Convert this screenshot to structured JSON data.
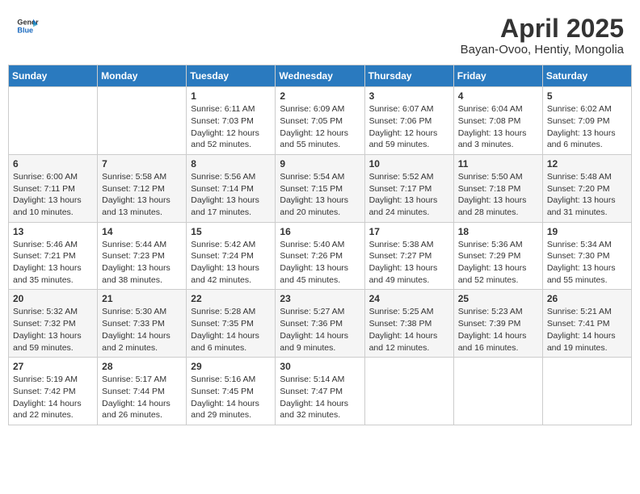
{
  "header": {
    "logo_line1": "General",
    "logo_line2": "Blue",
    "title": "April 2025",
    "subtitle": "Bayan-Ovoo, Hentiy, Mongolia"
  },
  "weekdays": [
    "Sunday",
    "Monday",
    "Tuesday",
    "Wednesday",
    "Thursday",
    "Friday",
    "Saturday"
  ],
  "weeks": [
    [
      {
        "day": "",
        "info": ""
      },
      {
        "day": "",
        "info": ""
      },
      {
        "day": "1",
        "info": "Sunrise: 6:11 AM\nSunset: 7:03 PM\nDaylight: 12 hours\nand 52 minutes."
      },
      {
        "day": "2",
        "info": "Sunrise: 6:09 AM\nSunset: 7:05 PM\nDaylight: 12 hours\nand 55 minutes."
      },
      {
        "day": "3",
        "info": "Sunrise: 6:07 AM\nSunset: 7:06 PM\nDaylight: 12 hours\nand 59 minutes."
      },
      {
        "day": "4",
        "info": "Sunrise: 6:04 AM\nSunset: 7:08 PM\nDaylight: 13 hours\nand 3 minutes."
      },
      {
        "day": "5",
        "info": "Sunrise: 6:02 AM\nSunset: 7:09 PM\nDaylight: 13 hours\nand 6 minutes."
      }
    ],
    [
      {
        "day": "6",
        "info": "Sunrise: 6:00 AM\nSunset: 7:11 PM\nDaylight: 13 hours\nand 10 minutes."
      },
      {
        "day": "7",
        "info": "Sunrise: 5:58 AM\nSunset: 7:12 PM\nDaylight: 13 hours\nand 13 minutes."
      },
      {
        "day": "8",
        "info": "Sunrise: 5:56 AM\nSunset: 7:14 PM\nDaylight: 13 hours\nand 17 minutes."
      },
      {
        "day": "9",
        "info": "Sunrise: 5:54 AM\nSunset: 7:15 PM\nDaylight: 13 hours\nand 20 minutes."
      },
      {
        "day": "10",
        "info": "Sunrise: 5:52 AM\nSunset: 7:17 PM\nDaylight: 13 hours\nand 24 minutes."
      },
      {
        "day": "11",
        "info": "Sunrise: 5:50 AM\nSunset: 7:18 PM\nDaylight: 13 hours\nand 28 minutes."
      },
      {
        "day": "12",
        "info": "Sunrise: 5:48 AM\nSunset: 7:20 PM\nDaylight: 13 hours\nand 31 minutes."
      }
    ],
    [
      {
        "day": "13",
        "info": "Sunrise: 5:46 AM\nSunset: 7:21 PM\nDaylight: 13 hours\nand 35 minutes."
      },
      {
        "day": "14",
        "info": "Sunrise: 5:44 AM\nSunset: 7:23 PM\nDaylight: 13 hours\nand 38 minutes."
      },
      {
        "day": "15",
        "info": "Sunrise: 5:42 AM\nSunset: 7:24 PM\nDaylight: 13 hours\nand 42 minutes."
      },
      {
        "day": "16",
        "info": "Sunrise: 5:40 AM\nSunset: 7:26 PM\nDaylight: 13 hours\nand 45 minutes."
      },
      {
        "day": "17",
        "info": "Sunrise: 5:38 AM\nSunset: 7:27 PM\nDaylight: 13 hours\nand 49 minutes."
      },
      {
        "day": "18",
        "info": "Sunrise: 5:36 AM\nSunset: 7:29 PM\nDaylight: 13 hours\nand 52 minutes."
      },
      {
        "day": "19",
        "info": "Sunrise: 5:34 AM\nSunset: 7:30 PM\nDaylight: 13 hours\nand 55 minutes."
      }
    ],
    [
      {
        "day": "20",
        "info": "Sunrise: 5:32 AM\nSunset: 7:32 PM\nDaylight: 13 hours\nand 59 minutes."
      },
      {
        "day": "21",
        "info": "Sunrise: 5:30 AM\nSunset: 7:33 PM\nDaylight: 14 hours\nand 2 minutes."
      },
      {
        "day": "22",
        "info": "Sunrise: 5:28 AM\nSunset: 7:35 PM\nDaylight: 14 hours\nand 6 minutes."
      },
      {
        "day": "23",
        "info": "Sunrise: 5:27 AM\nSunset: 7:36 PM\nDaylight: 14 hours\nand 9 minutes."
      },
      {
        "day": "24",
        "info": "Sunrise: 5:25 AM\nSunset: 7:38 PM\nDaylight: 14 hours\nand 12 minutes."
      },
      {
        "day": "25",
        "info": "Sunrise: 5:23 AM\nSunset: 7:39 PM\nDaylight: 14 hours\nand 16 minutes."
      },
      {
        "day": "26",
        "info": "Sunrise: 5:21 AM\nSunset: 7:41 PM\nDaylight: 14 hours\nand 19 minutes."
      }
    ],
    [
      {
        "day": "27",
        "info": "Sunrise: 5:19 AM\nSunset: 7:42 PM\nDaylight: 14 hours\nand 22 minutes."
      },
      {
        "day": "28",
        "info": "Sunrise: 5:17 AM\nSunset: 7:44 PM\nDaylight: 14 hours\nand 26 minutes."
      },
      {
        "day": "29",
        "info": "Sunrise: 5:16 AM\nSunset: 7:45 PM\nDaylight: 14 hours\nand 29 minutes."
      },
      {
        "day": "30",
        "info": "Sunrise: 5:14 AM\nSunset: 7:47 PM\nDaylight: 14 hours\nand 32 minutes."
      },
      {
        "day": "",
        "info": ""
      },
      {
        "day": "",
        "info": ""
      },
      {
        "day": "",
        "info": ""
      }
    ]
  ]
}
